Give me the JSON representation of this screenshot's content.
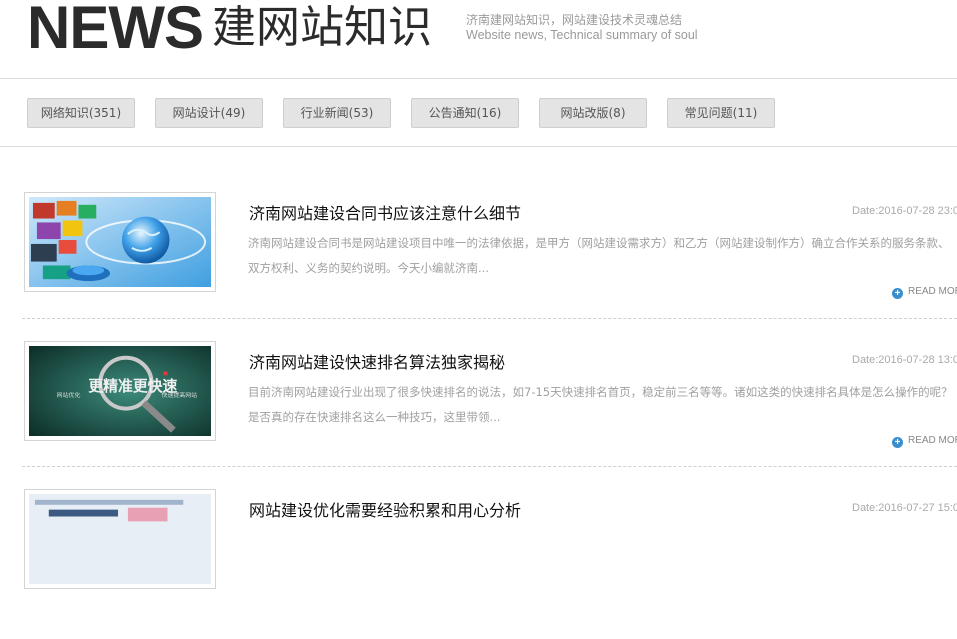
{
  "header": {
    "news": "NEWS",
    "title": "建网站知识",
    "subtitle_cn": "济南建网站知识，网站建设技术灵魂总结",
    "subtitle_en": "Website news, Technical summary of soul"
  },
  "categories": [
    {
      "label": "网络知识(351)"
    },
    {
      "label": "网站设计(49)"
    },
    {
      "label": "行业新闻(53)"
    },
    {
      "label": "公告通知(16)"
    },
    {
      "label": "网站改版(8)"
    },
    {
      "label": "常见问题(11)"
    }
  ],
  "articles": [
    {
      "title": "济南网站建设合同书应该注意什么细节",
      "date": "Date:2016-07-28 23:0",
      "summary": "济南网站建设合同书是网站建设项目中唯一的法律依据，是甲方（网站建设需求方）和乙方（网站建设制作方）确立合作关系的服务条款、双方权利、义务的契约说明。今天小编就济南...",
      "readmore": "READ MOR"
    },
    {
      "title": "济南网站建设快速排名算法独家揭秘",
      "date": "Date:2016-07-28 13:0",
      "summary": "目前济南网站建设行业出现了很多快速排名的说法，如7-15天快速排名首页，稳定前三名等等。诸如这类的快速排名具体是怎么操作的呢？是否真的存在快速排名这么一种技巧，这里带领...",
      "readmore": "READ MOR",
      "image_text": {
        "left": "网站优化",
        "main": "更精准更快速",
        "right": "快速提高网站"
      }
    },
    {
      "title": "网站建设优化需要经验积累和用心分析",
      "date": "Date:2016-07-27 15:0"
    }
  ],
  "colors": {
    "accent": "#3a8ecd",
    "button_bg": "#e4e4e4",
    "muted_text": "#a0a0a0"
  }
}
